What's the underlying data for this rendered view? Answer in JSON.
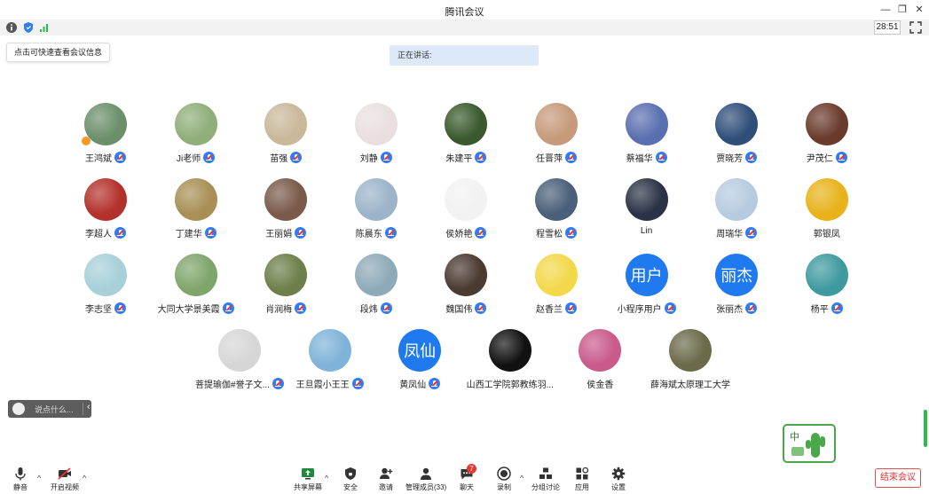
{
  "window": {
    "title": "腾讯会议",
    "controls": [
      "minimize-icon",
      "restore-icon",
      "close-icon"
    ]
  },
  "topbar": {
    "timer": "28:51",
    "tooltip": "点击可快速查看会议信息"
  },
  "speaking": {
    "label": "正在讲话:"
  },
  "participants": [
    {
      "name": "王鸿斌",
      "avatar": "photo",
      "color": "#6b8f6a",
      "host": true,
      "mic": true
    },
    {
      "name": "Ji老师",
      "avatar": "photo",
      "color": "#8fae7a",
      "mic": true
    },
    {
      "name": "苗强",
      "avatar": "photo",
      "color": "#c9b89a",
      "mic": true
    },
    {
      "name": "刘静",
      "avatar": "photo",
      "color": "#e9dfe0",
      "mic": true
    },
    {
      "name": "朱建平",
      "avatar": "photo",
      "color": "#3a5a2d",
      "mic": true
    },
    {
      "name": "任晋萍",
      "avatar": "photo",
      "color": "#c79a7b",
      "mic": true
    },
    {
      "name": "蔡福华",
      "avatar": "photo",
      "color": "#5a6fb0",
      "mic": true
    },
    {
      "name": "贾晓芳",
      "avatar": "photo",
      "color": "#2f4f7a",
      "mic": true
    },
    {
      "name": "尹茂仁",
      "avatar": "photo",
      "color": "#6a3b2c",
      "mic": true
    },
    {
      "name": "李超人",
      "avatar": "photo",
      "color": "#b3312b",
      "mic": true
    },
    {
      "name": "丁建华",
      "avatar": "photo",
      "color": "#a88f55",
      "mic": true
    },
    {
      "name": "王丽娟",
      "avatar": "photo",
      "color": "#7a5a4a",
      "mic": true
    },
    {
      "name": "陈晨东",
      "avatar": "photo",
      "color": "#9bb4c9",
      "mic": true
    },
    {
      "name": "侯娇艳",
      "avatar": "photo",
      "color": "#f2f2f2",
      "mic": true
    },
    {
      "name": "程雪松",
      "avatar": "photo",
      "color": "#4a5f7a",
      "mic": true
    },
    {
      "name": "Lin",
      "avatar": "photo",
      "color": "#2a3346",
      "mic": false
    },
    {
      "name": "周瑞华",
      "avatar": "photo",
      "color": "#b7cbe0",
      "mic": true
    },
    {
      "name": "郭银凤",
      "avatar": "photo",
      "color": "#e7b21a",
      "mic": false
    },
    {
      "name": "李志坚",
      "avatar": "photo",
      "color": "#a7d0d8",
      "mic": true
    },
    {
      "name": "大同大学景美霞",
      "avatar": "photo",
      "color": "#7fa56b",
      "mic": true
    },
    {
      "name": "肖润梅",
      "avatar": "photo",
      "color": "#6d7f4a",
      "mic": true
    },
    {
      "name": "段炜",
      "avatar": "photo",
      "color": "#8eaab8",
      "mic": true
    },
    {
      "name": "魏国伟",
      "avatar": "photo",
      "color": "#4a3a30",
      "mic": true
    },
    {
      "name": "赵香兰",
      "avatar": "photo",
      "color": "#f3d84a",
      "mic": true
    },
    {
      "name": "小程序用户",
      "avatar": "text",
      "text": "用户",
      "mic": true
    },
    {
      "name": "张丽杰",
      "avatar": "text",
      "text": "丽杰",
      "mic": true
    },
    {
      "name": "杨平",
      "avatar": "photo",
      "color": "#3f9aa0",
      "mic": true
    },
    {
      "name": "菩提瑜伽#誉子文...",
      "avatar": "photo",
      "color": "#d6d6d6",
      "mic": true
    },
    {
      "name": "王旦霞小王王",
      "avatar": "photo",
      "color": "#7fb3d9",
      "mic": true
    },
    {
      "name": "黄凤仙",
      "avatar": "text",
      "text": "凤仙",
      "mic": true
    },
    {
      "name": "山西工学院郭教练羽...",
      "avatar": "photo",
      "color": "#111111",
      "mic": false
    },
    {
      "name": "侯金香",
      "avatar": "photo",
      "color": "#c95a8a",
      "mic": false
    },
    {
      "name": "薛海斌太原理工大学",
      "avatar": "photo",
      "color": "#6b6a4a",
      "mic": false
    }
  ],
  "chat": {
    "placeholder": "说点什么..."
  },
  "selfview": {
    "text": "中",
    "color": "#4aa84a"
  },
  "toolbar": {
    "mute": "静音",
    "video": "开启视频",
    "share": "共享屏幕",
    "security": "安全",
    "invite": "邀请",
    "members": "管理成员(33)",
    "chat": "聊天",
    "chat_badge": "7",
    "record": "录制",
    "breakout": "分组讨论",
    "apps": "应用",
    "settings": "设置",
    "end": "结束会议"
  }
}
